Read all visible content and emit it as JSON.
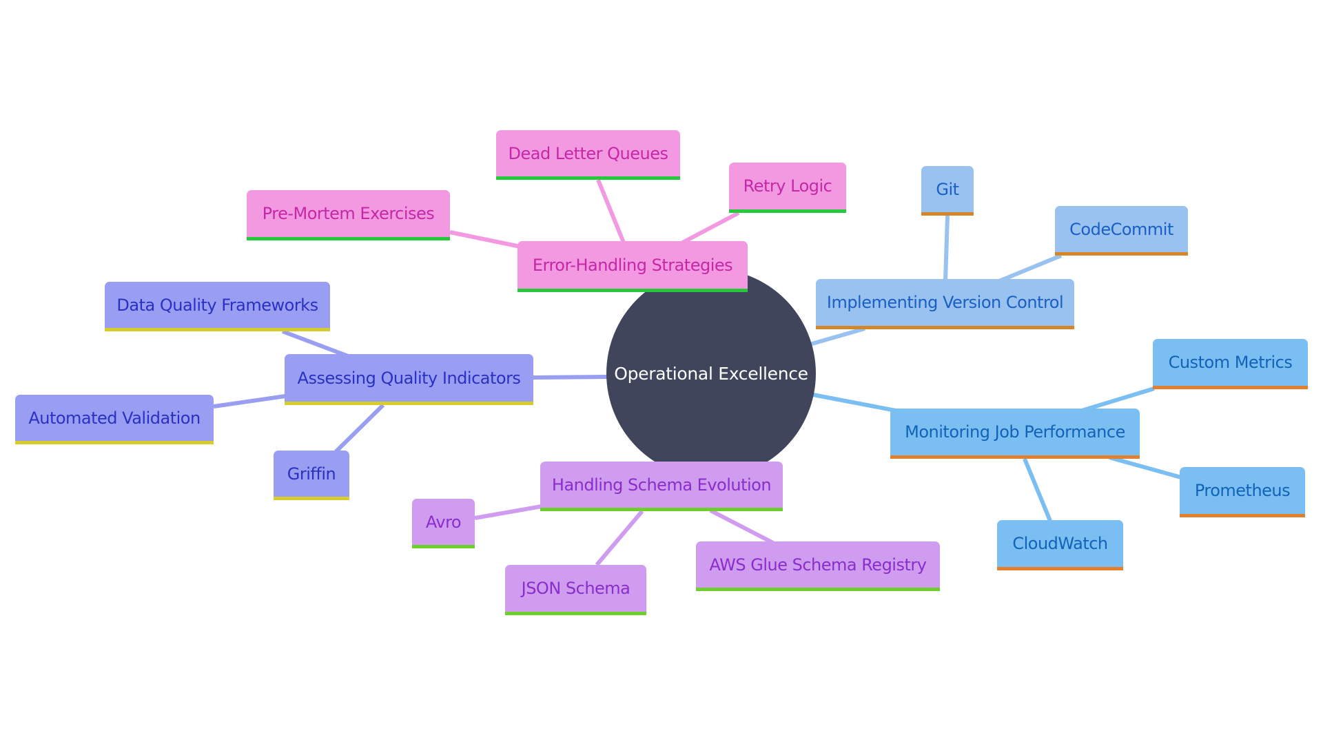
{
  "diagram": {
    "type": "mindmap",
    "root": {
      "id": "root",
      "label": "Operational Excellence",
      "fill": "#40455c",
      "text_color": "#ffffff"
    },
    "branches": [
      {
        "id": "error",
        "label": "Error-Handling Strategies",
        "fill": "#f399e2",
        "text_color": "#c428a6",
        "underline": "#26c93c",
        "edge_color": "#f399e2",
        "children": [
          {
            "id": "dlq",
            "label": "Dead Letter Queues"
          },
          {
            "id": "retry",
            "label": "Retry Logic"
          },
          {
            "id": "premortem",
            "label": "Pre-Mortem Exercises"
          }
        ]
      },
      {
        "id": "version",
        "label": "Implementing Version Control",
        "fill": "#99c2f0",
        "text_color": "#1a5fc4",
        "underline": "#d4862a",
        "edge_color": "#99c2f0",
        "children": [
          {
            "id": "git",
            "label": "Git"
          },
          {
            "id": "codecommit",
            "label": "CodeCommit"
          }
        ]
      },
      {
        "id": "monitoring",
        "label": "Monitoring Job Performance",
        "fill": "#7bbff2",
        "text_color": "#1262b8",
        "underline": "#e2802f",
        "edge_color": "#7bbff2",
        "children": [
          {
            "id": "custom",
            "label": "Custom Metrics"
          },
          {
            "id": "prometheus",
            "label": "Prometheus"
          },
          {
            "id": "cloudwatch",
            "label": "CloudWatch"
          }
        ]
      },
      {
        "id": "quality",
        "label": "Assessing Quality Indicators",
        "fill": "#999ef2",
        "text_color": "#2a31c2",
        "underline": "#d6cc2a",
        "edge_color": "#999ef2",
        "children": [
          {
            "id": "dqf",
            "label": "Data Quality Frameworks"
          },
          {
            "id": "autoval",
            "label": "Automated Validation"
          },
          {
            "id": "griffin",
            "label": "Griffin"
          }
        ]
      },
      {
        "id": "schema",
        "label": "Handling Schema Evolution",
        "fill": "#cf9cf0",
        "text_color": "#8a2dcc",
        "underline": "#6ccf2c",
        "edge_color": "#cf9cf0",
        "children": [
          {
            "id": "avro",
            "label": "Avro"
          },
          {
            "id": "jsonschema",
            "label": "JSON Schema"
          },
          {
            "id": "glue",
            "label": "AWS Glue Schema Registry"
          }
        ]
      }
    ]
  }
}
